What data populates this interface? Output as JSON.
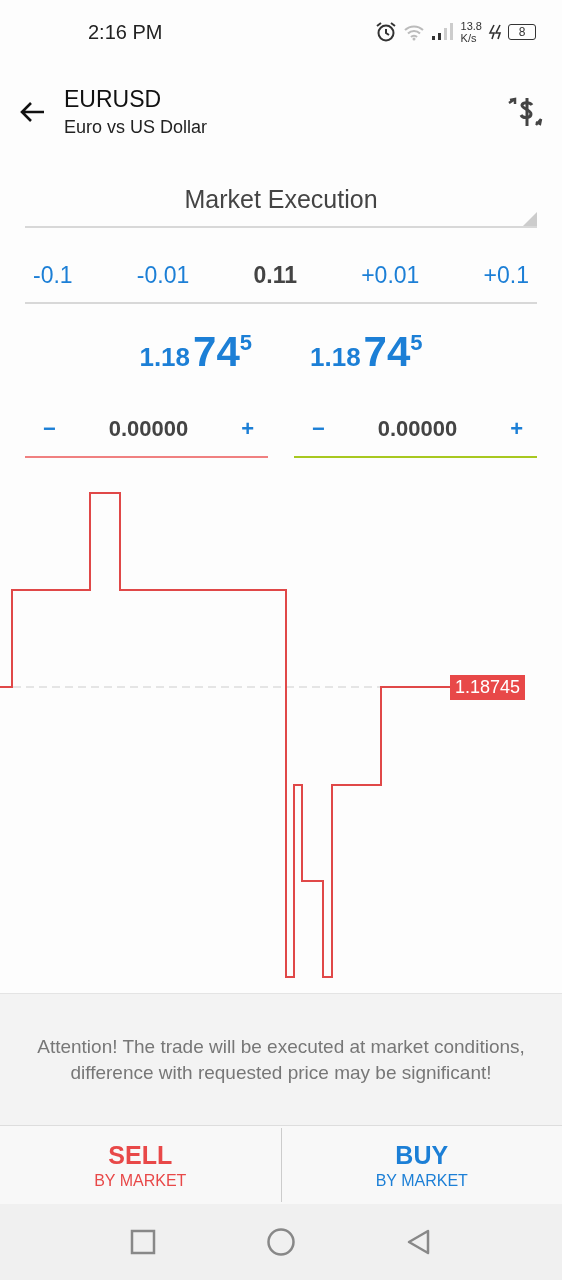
{
  "status_bar": {
    "time": "2:16 PM",
    "speed_value": "13.8",
    "speed_unit": "K/s",
    "battery": "8"
  },
  "header": {
    "symbol": "EURUSD",
    "description": "Euro vs US Dollar"
  },
  "execution": {
    "value": "Market Execution"
  },
  "volume_steps": [
    {
      "label": "-0.1",
      "kind": "step"
    },
    {
      "label": "-0.01",
      "kind": "step"
    },
    {
      "label": "0.11",
      "kind": "value"
    },
    {
      "label": "+0.01",
      "kind": "step"
    },
    {
      "label": "+0.1",
      "kind": "step"
    }
  ],
  "quotes": [
    {
      "prefix": "1.18",
      "big": "74",
      "sup": "5"
    },
    {
      "prefix": "1.18",
      "big": "74",
      "sup": "5"
    }
  ],
  "levels": [
    {
      "minus": "−",
      "value": "0.00000",
      "plus": "+",
      "color": "#f08080"
    },
    {
      "minus": "−",
      "value": "0.00000",
      "plus": "+",
      "color": "#a8c820"
    }
  ],
  "chart": {
    "price_label": "1.18745"
  },
  "notice": "Attention! The trade will be executed at market conditions, difference with requested price may be significant!",
  "actions": [
    {
      "label": "SELL",
      "sub": "BY MARKET",
      "kind": "sell"
    },
    {
      "label": "BUY",
      "sub": "BY MARKET",
      "kind": "buy"
    }
  ]
}
